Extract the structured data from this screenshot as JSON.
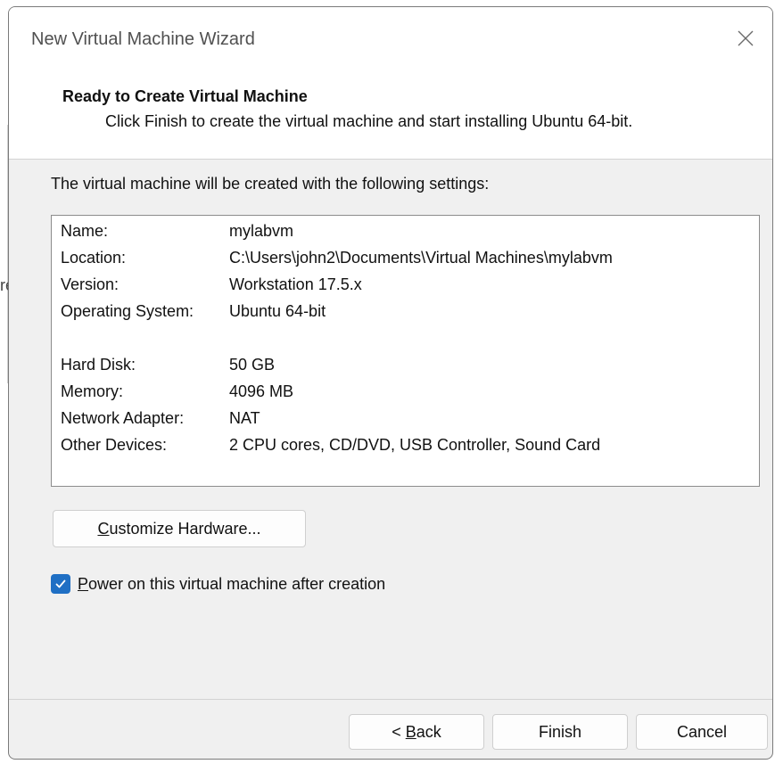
{
  "window": {
    "title": "New Virtual Machine Wizard"
  },
  "header": {
    "title": "Ready to Create Virtual Machine",
    "subtitle": "Click Finish to create the virtual machine and start installing Ubuntu 64-bit."
  },
  "intro": "The virtual machine will be created with the following settings:",
  "settings": {
    "group1": [
      {
        "label": "Name:",
        "value": "mylabvm"
      },
      {
        "label": "Location:",
        "value": "C:\\Users\\john2\\Documents\\Virtual Machines\\mylabvm"
      },
      {
        "label": "Version:",
        "value": "Workstation 17.5.x"
      },
      {
        "label": "Operating System:",
        "value": "Ubuntu 64-bit"
      }
    ],
    "group2": [
      {
        "label": "Hard Disk:",
        "value": "50 GB"
      },
      {
        "label": "Memory:",
        "value": "4096 MB"
      },
      {
        "label": "Network Adapter:",
        "value": "NAT"
      },
      {
        "label": "Other Devices:",
        "value": "2 CPU cores, CD/DVD, USB Controller, Sound Card"
      }
    ]
  },
  "customize": {
    "mnemonic": "C",
    "rest": "ustomize Hardware..."
  },
  "power_on": {
    "checked": true,
    "mnemonic": "P",
    "rest": "ower on this virtual machine after creation"
  },
  "buttons": {
    "back_prefix": "< ",
    "back_mnemonic": "B",
    "back_rest": "ack",
    "finish": "Finish",
    "cancel": "Cancel"
  },
  "background": {
    "fragment": "re"
  },
  "colors": {
    "accent": "#1f6fc4"
  }
}
